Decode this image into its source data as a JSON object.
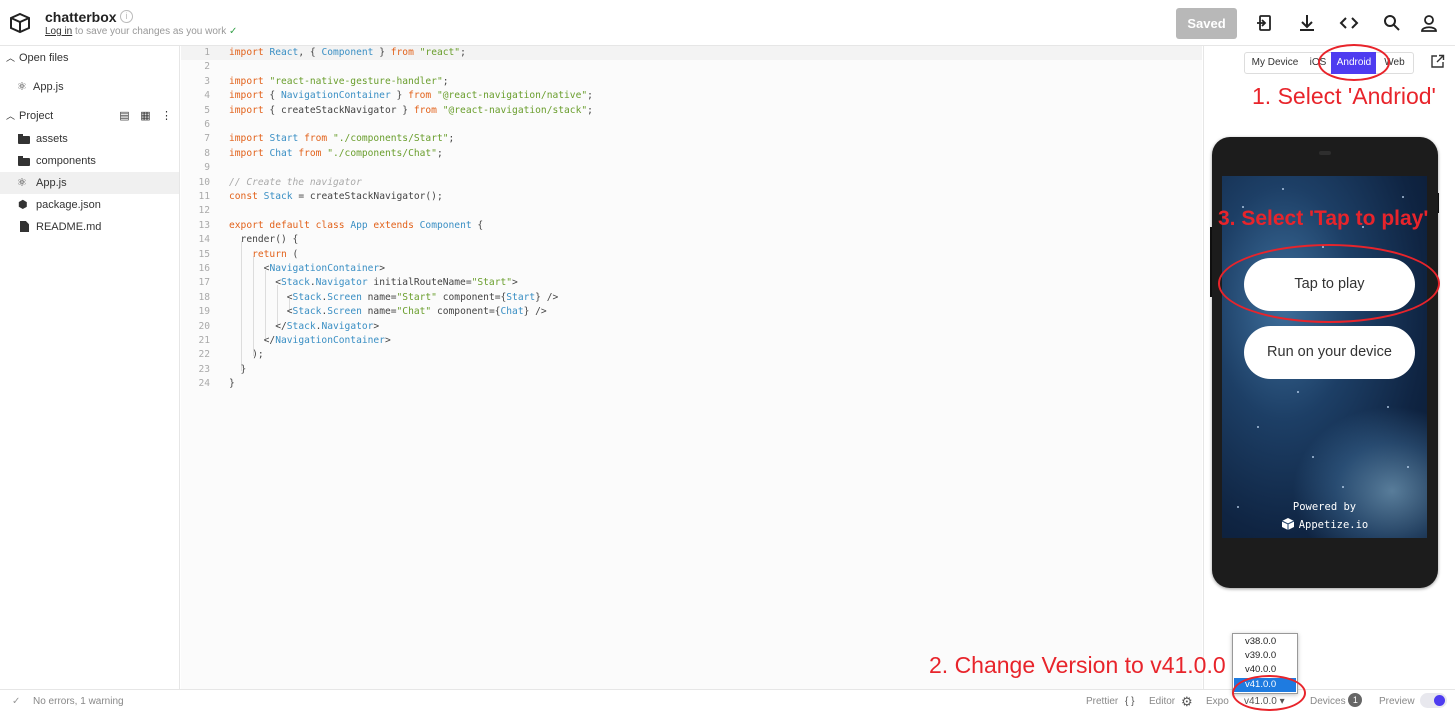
{
  "header": {
    "title": "chatterbox",
    "login_link": "Log in",
    "login_suffix": " to save your changes as you work",
    "check": "✓",
    "saved_label": "Saved"
  },
  "sidebar": {
    "open_files_label": "Open files",
    "open_file": "App.js",
    "project_label": "Project",
    "tree": [
      "assets",
      "components",
      "App.js",
      "package.json",
      "README.md"
    ]
  },
  "editor": {
    "line_numbers": [
      "1",
      "2",
      "3",
      "4",
      "5",
      "6",
      "7",
      "8",
      "9",
      "10",
      "11",
      "12",
      "13",
      "14",
      "15",
      "16",
      "17",
      "18",
      "19",
      "20",
      "21",
      "22",
      "23",
      "24"
    ]
  },
  "preview": {
    "tabs": [
      "My Device",
      "iOS",
      "Android",
      "Web"
    ],
    "active_tab": "Android",
    "tap_to_play": "Tap to play",
    "run_on_device": "Run on your device",
    "powered_by": "Powered by",
    "appetize": "Appetize.io"
  },
  "annotations": {
    "step1": "1. Select 'Andriod'",
    "step2": "2. Change Version to v41.0.0",
    "step3": "3. Select 'Tap to play'"
  },
  "version_dropdown": {
    "options": [
      "v38.0.0",
      "v39.0.0",
      "v40.0.0",
      "v41.0.0"
    ],
    "selected": "v41.0.0"
  },
  "footer": {
    "status": "No errors, 1 warning",
    "prettier": "Prettier",
    "prettier_icon": "{ }",
    "editor": "Editor",
    "expo": "Expo",
    "version": "v41.0.0 ▾",
    "devices": "Devices",
    "devices_count": "1",
    "preview": "Preview"
  }
}
